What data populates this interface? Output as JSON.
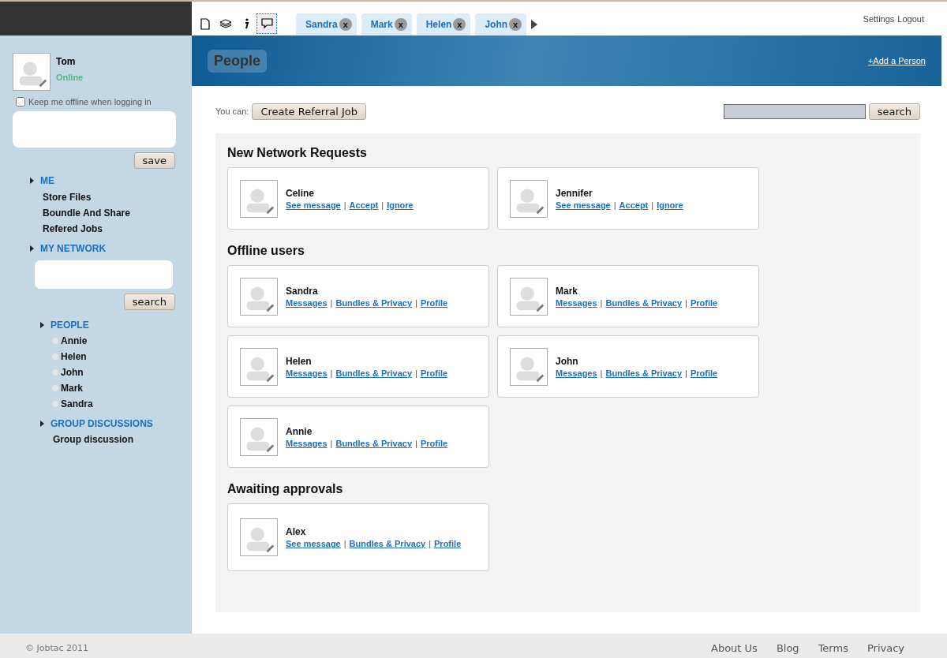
{
  "toolbar": {
    "icons": [
      {
        "kind": "page",
        "selected": false
      },
      {
        "kind": "layers",
        "selected": false
      },
      {
        "kind": "info",
        "selected": false
      },
      {
        "kind": "chat",
        "selected": true
      }
    ]
  },
  "tabs": [
    {
      "label": "Sandra",
      "close": "x"
    },
    {
      "label": "Mark",
      "close": "x"
    },
    {
      "label": "Helen",
      "close": "x"
    },
    {
      "label": "John",
      "close": "x"
    }
  ],
  "top_links": [
    "Settings",
    "Logout"
  ],
  "profile": {
    "name": "Tom",
    "status": "Online",
    "keep_offline": {
      "label": "Keep me offline when logging in",
      "checked": false
    },
    "save_button": "save"
  },
  "nav": [
    {
      "label": "ME",
      "children": [
        {
          "label": "Store Files"
        },
        {
          "label": "Boundle And Share"
        },
        {
          "label": "Refered Jobs"
        }
      ]
    },
    {
      "label": "MY NETWORK",
      "search_button": "search",
      "children": [
        {
          "label": "PEOPLE",
          "children": [
            {
              "label": "Annie"
            },
            {
              "label": "Helen"
            },
            {
              "label": "John"
            },
            {
              "label": "Mark"
            },
            {
              "label": "Sandra"
            }
          ]
        },
        {
          "label": "GROUP DISCUSSIONS",
          "children": [
            {
              "label": "Group discussion"
            }
          ]
        }
      ]
    }
  ],
  "header": {
    "title": "People",
    "add_link": "+Add a Person"
  },
  "actions": {
    "label": "You can:",
    "button": "Create Referral Job",
    "search_button": "search"
  },
  "sections": [
    {
      "title": "New Network Requests",
      "cards": [
        {
          "name": "Celine",
          "links": [
            {
              "kind": "link",
              "text": "See message"
            },
            {
              "kind": "separator",
              "text": "|"
            },
            {
              "kind": "link",
              "text": "Accept"
            },
            {
              "kind": "separator",
              "text": "|"
            },
            {
              "kind": "link",
              "text": "Ignore"
            }
          ]
        },
        {
          "name": "Jennifer",
          "links": [
            {
              "kind": "link",
              "text": "See message"
            },
            {
              "kind": "separator",
              "text": "|"
            },
            {
              "kind": "link",
              "text": "Accept"
            },
            {
              "kind": "separator",
              "text": "|"
            },
            {
              "kind": "link",
              "text": "Ignore"
            }
          ]
        }
      ]
    },
    {
      "title": "Offline users",
      "cards": [
        {
          "name": "Sandra",
          "links": [
            {
              "kind": "link",
              "text": "Messages"
            },
            {
              "kind": "separator",
              "text": "|"
            },
            {
              "kind": "link",
              "text": "Bundles & Privacy"
            },
            {
              "kind": "separator",
              "text": "|"
            },
            {
              "kind": "link",
              "text": "Profile"
            }
          ]
        },
        {
          "name": "Mark",
          "links": [
            {
              "kind": "link",
              "text": "Messages"
            },
            {
              "kind": "separator",
              "text": "|"
            },
            {
              "kind": "link",
              "text": "Bundles & Privacy"
            },
            {
              "kind": "separator",
              "text": "|"
            },
            {
              "kind": "link",
              "text": "Profile"
            }
          ]
        },
        {
          "name": "Helen",
          "links": [
            {
              "kind": "link",
              "text": "Messages"
            },
            {
              "kind": "separator",
              "text": "|"
            },
            {
              "kind": "link",
              "text": "Bundles & Privacy"
            },
            {
              "kind": "separator",
              "text": "|"
            },
            {
              "kind": "link",
              "text": "Profile"
            }
          ]
        },
        {
          "name": "John",
          "links": [
            {
              "kind": "link",
              "text": "Messages"
            },
            {
              "kind": "separator",
              "text": "|"
            },
            {
              "kind": "link",
              "text": "Bundles & Privacy"
            },
            {
              "kind": "separator",
              "text": "|"
            },
            {
              "kind": "link",
              "text": "Profile"
            }
          ]
        },
        {
          "name": "Annie",
          "links": [
            {
              "kind": "link",
              "text": "Messages"
            },
            {
              "kind": "separator",
              "text": "|"
            },
            {
              "kind": "link",
              "text": "Bundles & Privacy"
            },
            {
              "kind": "separator",
              "text": "|"
            },
            {
              "kind": "link",
              "text": "Profile"
            }
          ]
        }
      ]
    },
    {
      "title": "Awaiting approvals",
      "cards": [
        {
          "name": "Alex",
          "links": [
            {
              "kind": "link",
              "text": "See message"
            },
            {
              "kind": "separator",
              "text": "|"
            },
            {
              "kind": "link",
              "text": "Bundles & Privacy"
            },
            {
              "kind": "separator",
              "text": "|"
            },
            {
              "kind": "link",
              "text": "Profile"
            }
          ]
        }
      ]
    }
  ],
  "footer": {
    "copyright": "© Jobtac 2011",
    "links": [
      "About Us",
      "Blog",
      "Terms",
      "Privacy"
    ]
  }
}
